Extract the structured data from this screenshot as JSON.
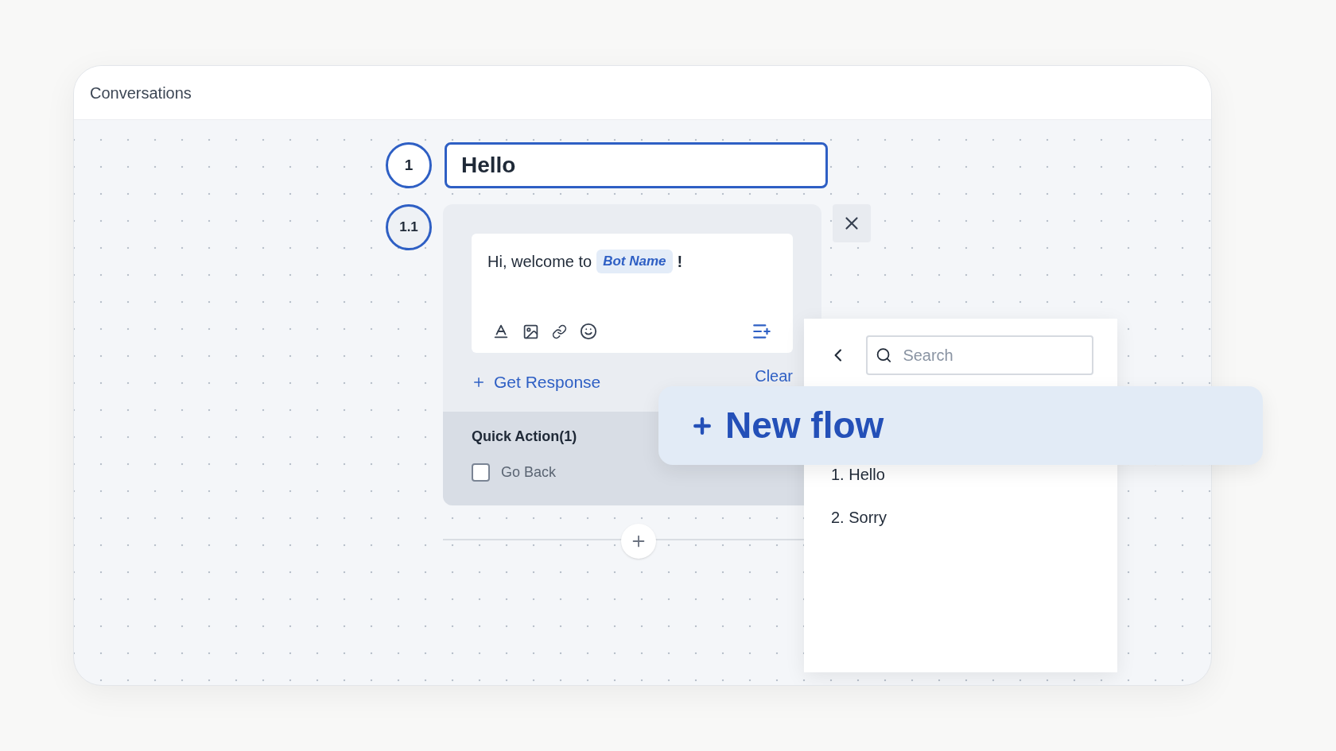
{
  "window": {
    "title": "Conversations"
  },
  "step": {
    "number": "1",
    "title": "Hello"
  },
  "response": {
    "number": "1.1",
    "message": {
      "text": "Hi, welcome to",
      "variable": "Bot Name",
      "suffix": "!"
    },
    "add_response": "Get Response",
    "clear": "Clear",
    "quick_actions": {
      "title": "Quick Action(1)",
      "items": [
        {
          "label": "Go Back",
          "checked": false
        }
      ]
    }
  },
  "popup": {
    "search": {
      "placeholder": "Search"
    },
    "flows": [
      {
        "label": "1. Hello"
      },
      {
        "label": "2. Sorry"
      }
    ]
  },
  "banner": {
    "label": "New flow"
  }
}
